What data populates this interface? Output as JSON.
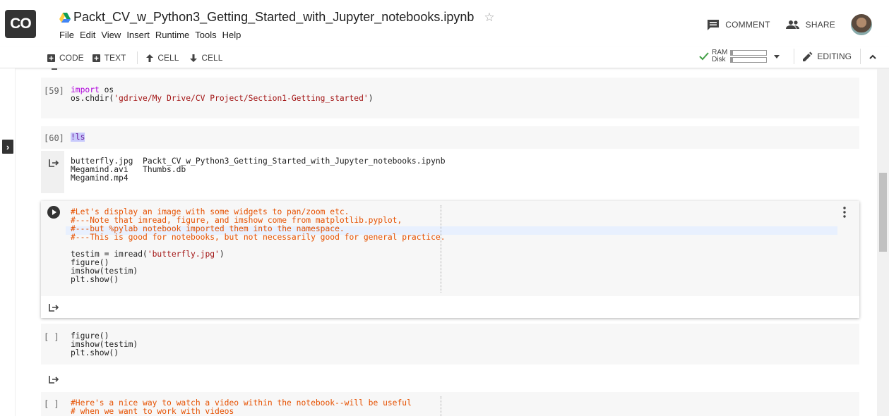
{
  "app": {
    "logo": "CO"
  },
  "notebook": {
    "title": "Packt_CV_w_Python3_Getting_Started_with_Jupyter_notebooks.ipynb",
    "menu": [
      "File",
      "Edit",
      "View",
      "Insert",
      "Runtime",
      "Tools",
      "Help"
    ]
  },
  "header": {
    "comment_label": "COMMENT",
    "share_label": "SHARE"
  },
  "toolbar": {
    "code_label": "CODE",
    "text_label": "TEXT",
    "cell_up_label": "CELL",
    "cell_down_label": "CELL",
    "ram_label": "RAM",
    "disk_label": "Disk",
    "editing_label": "EDITING"
  },
  "cells": {
    "c59": {
      "count": "[59]",
      "line1_kw": "import",
      "line1_rest": " os",
      "line2_pre": "os.chdir(",
      "line2_str": "'gdrive/My Drive/CV Project/Section1-Getting_started'",
      "line2_post": ")"
    },
    "c60": {
      "count": "[60]",
      "code": "!ls",
      "output": "butterfly.jpg  Packt_CV_w_Python3_Getting_Started_with_Jupyter_notebooks.ipynb\nMegamind.avi   Thumbs.db\nMegamind.mp4"
    },
    "active": {
      "comment1": "#Let's display an image with some widgets to pan/zoom etc.",
      "comment2": "#---Note that imread, figure, and imshow come from matplotlib.pyplot,",
      "comment3": "#---but %pylab notebook imported them into the namespace.",
      "comment4": "#---This is good for notebooks, but not necessarily good for general practice.",
      "line5_pre": "testim = imread(",
      "line5_str": "'butterfly.jpg'",
      "line5_post": ")",
      "line6": "figure()",
      "line7": "imshow(testim)",
      "line8": "plt.show()"
    },
    "c_figure": {
      "count": "[ ]",
      "code": "figure()\nimshow(testim)\nplt.show()"
    },
    "c_video": {
      "count": "[ ]",
      "comment1": "#Here's a nice way to watch a video within the notebook--will be useful",
      "comment2": "# when we want to work with videos"
    }
  },
  "colors": {
    "accent": "#4285f4",
    "ok_check": "#43a047",
    "comment": "#e65100",
    "string": "#a31515",
    "keyword": "#af00db"
  }
}
